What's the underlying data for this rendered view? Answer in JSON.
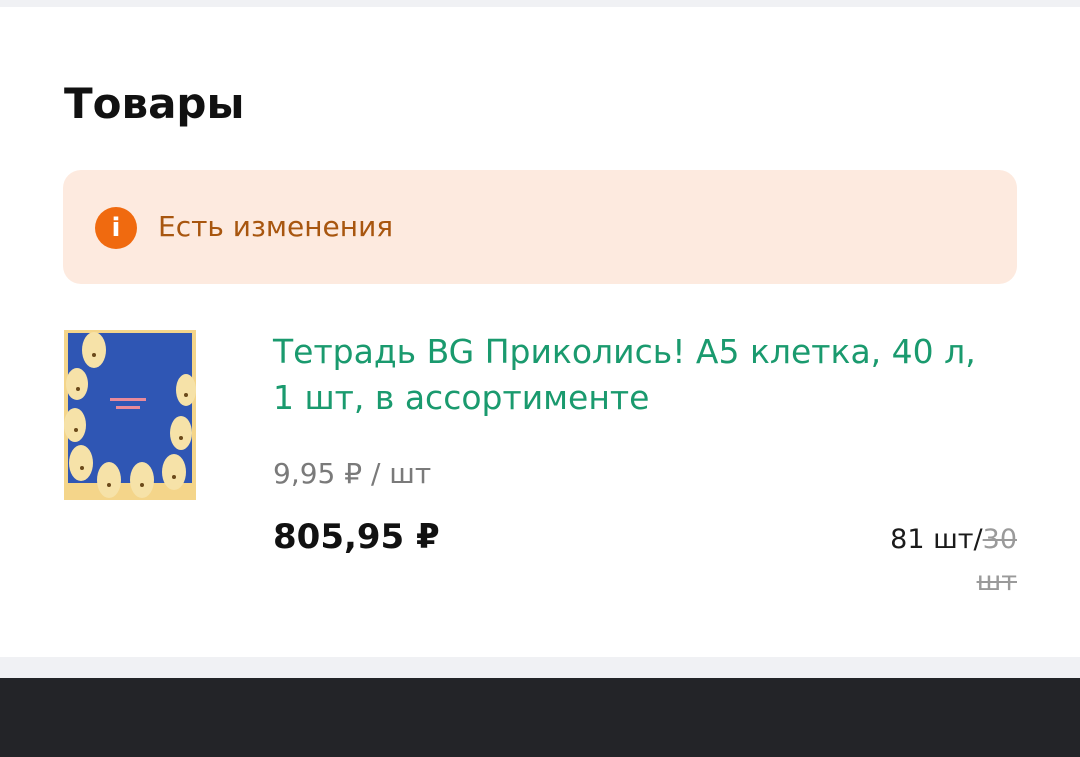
{
  "page": {
    "title": "Товары"
  },
  "alert": {
    "icon": "info-icon",
    "icon_glyph": "i",
    "text": "Есть изменения",
    "colors": {
      "background": "#fdeadf",
      "icon": "#f06a0f",
      "text": "#a8560f"
    }
  },
  "product": {
    "image": "notebook-cover-image",
    "name": "Тетрадь BG Приколись! A5 клетка, 40 л, 1 шт, в ассортименте",
    "unit_price": "9,95 ₽ / шт",
    "total_price": "805,95 ₽",
    "quantity_new": "81 шт/",
    "quantity_old": "30 шт",
    "colors": {
      "name": "#1a9a6e"
    }
  }
}
